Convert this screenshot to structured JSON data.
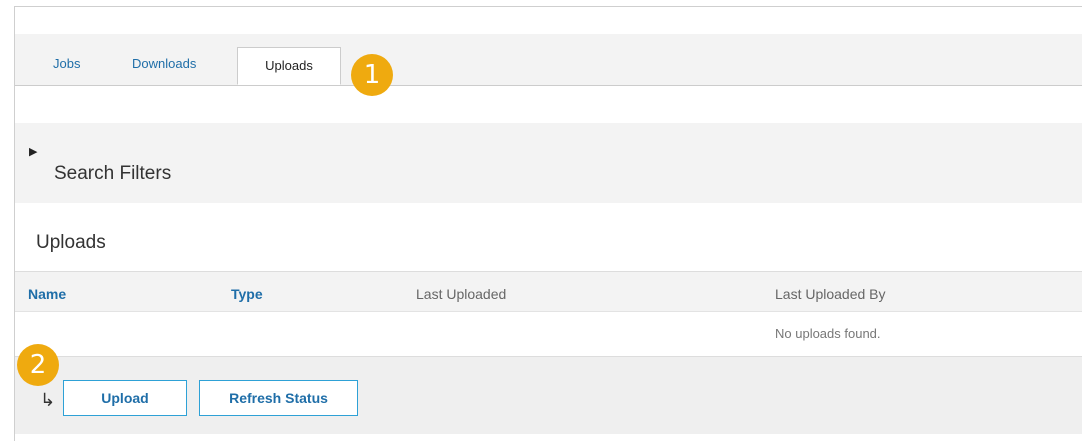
{
  "tabs": [
    {
      "label": "Jobs",
      "active": false
    },
    {
      "label": "Downloads",
      "active": false
    },
    {
      "label": "Uploads",
      "active": true
    }
  ],
  "callouts": {
    "tabs_badge": "1",
    "actions_badge": "2"
  },
  "filters": {
    "label": "Search Filters",
    "toggle_icon": "triangle-right-icon"
  },
  "section": {
    "title": "Uploads"
  },
  "table": {
    "columns": [
      "Name",
      "Type",
      "Last Uploaded",
      "Last Uploaded By"
    ],
    "empty_message": "No uploads found."
  },
  "actions": {
    "corner_icon": "return-arrow-icon",
    "upload_label": "Upload",
    "refresh_label": "Refresh Status"
  },
  "colors": {
    "link": "#1f6ea8",
    "badge": "#efaa0f",
    "button_border": "#2ea1d6",
    "panel_bg": "#f3f3f3"
  }
}
